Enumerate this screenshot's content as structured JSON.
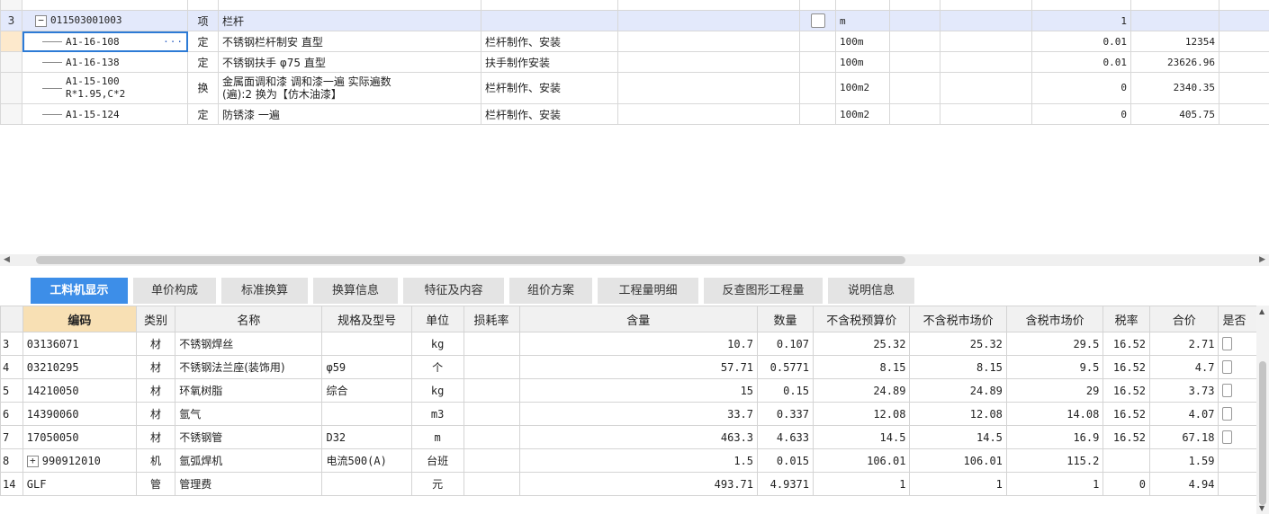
{
  "top_grid": {
    "rows": [
      {
        "idx": "",
        "code": "",
        "type": "",
        "name": "",
        "feature": "",
        "unit": "",
        "qty": "",
        "price": "",
        "partial": true
      },
      {
        "idx": "3",
        "code": "011503001003",
        "type": "项",
        "name": "栏杆",
        "feature": "",
        "unit": "m",
        "qty": "1",
        "price": "",
        "kind": "item"
      },
      {
        "idx": "",
        "code": "A1-16-108",
        "type": "定",
        "name": "不锈钢栏杆制安 直型",
        "feature": "栏杆制作、安装",
        "unit": "100m",
        "qty": "0.01",
        "price": "12354",
        "kind": "sub",
        "editing": true
      },
      {
        "idx": "",
        "code": "A1-16-138",
        "type": "定",
        "name": "不锈钢扶手 φ75 直型",
        "feature": "扶手制作安装",
        "unit": "100m",
        "qty": "0.01",
        "price": "23626.96",
        "kind": "sub"
      },
      {
        "idx": "",
        "code": "A1-15-100",
        "code2": "R*1.95,C*2",
        "type": "换",
        "name": "金属面调和漆 调和漆一遍  实际遍数",
        "name2": "(遍):2  换为【仿木油漆】",
        "feature": "栏杆制作、安装",
        "unit": "100m2",
        "qty": "0",
        "price": "2340.35",
        "kind": "sub2"
      },
      {
        "idx": "",
        "code": "A1-15-124",
        "type": "定",
        "name": "防锈漆 一遍",
        "feature": "栏杆制作、安装",
        "unit": "100m2",
        "qty": "0",
        "price": "405.75",
        "kind": "sub"
      }
    ]
  },
  "tabs": [
    "工料机显示",
    "单价构成",
    "标准换算",
    "换算信息",
    "特征及内容",
    "组价方案",
    "工程量明细",
    "反查图形工程量",
    "说明信息"
  ],
  "bottom_grid": {
    "headers": [
      "",
      "编码",
      "类别",
      "名称",
      "规格及型号",
      "单位",
      "损耗率",
      "含量",
      "数量",
      "不含税预算价",
      "不含税市场价",
      "含税市场价",
      "税率",
      "合价",
      "是否"
    ],
    "rows": [
      {
        "no": "3",
        "code": "03136071",
        "cat": "材",
        "name": "不锈钢焊丝",
        "spec": "",
        "unit": "kg",
        "loss": "",
        "content": "10.7",
        "qty": "0.107",
        "p1": "25.32",
        "p2": "25.32",
        "p3": "29.5",
        "tax": "16.52",
        "total": "2.71",
        "chk": true
      },
      {
        "no": "4",
        "code": "03210295",
        "cat": "材",
        "name": "不锈钢法兰座(装饰用)",
        "spec": "φ59",
        "unit": "个",
        "loss": "",
        "content": "57.71",
        "qty": "0.5771",
        "p1": "8.15",
        "p2": "8.15",
        "p3": "9.5",
        "tax": "16.52",
        "total": "4.7",
        "chk": true
      },
      {
        "no": "5",
        "code": "14210050",
        "cat": "材",
        "name": "环氧树脂",
        "spec": "综合",
        "unit": "kg",
        "loss": "",
        "content": "15",
        "qty": "0.15",
        "p1": "24.89",
        "p2": "24.89",
        "p3": "29",
        "tax": "16.52",
        "total": "3.73",
        "chk": true
      },
      {
        "no": "6",
        "code": "14390060",
        "cat": "材",
        "name": "氩气",
        "spec": "",
        "unit": "m3",
        "loss": "",
        "content": "33.7",
        "qty": "0.337",
        "p1": "12.08",
        "p2": "12.08",
        "p3": "14.08",
        "tax": "16.52",
        "total": "4.07",
        "chk": true
      },
      {
        "no": "7",
        "code": "17050050",
        "cat": "材",
        "name": "不锈钢管",
        "spec": "D32",
        "unit": "m",
        "loss": "",
        "content": "463.3",
        "qty": "4.633",
        "p1": "14.5",
        "p2": "14.5",
        "p3": "16.9",
        "tax": "16.52",
        "total": "67.18",
        "chk": true
      },
      {
        "no": "8",
        "code": "990912010",
        "cat": "机",
        "name": "氩弧焊机",
        "spec": "电流500(A)",
        "unit": "台班",
        "loss": "",
        "content": "1.5",
        "qty": "0.015",
        "p1": "106.01",
        "p2": "106.01",
        "p3": "115.2",
        "tax": "",
        "total": "1.59",
        "chk": false,
        "expand": true
      },
      {
        "no": "14",
        "code": "GLF",
        "cat": "管",
        "name": "管理费",
        "spec": "",
        "unit": "元",
        "loss": "",
        "content": "493.71",
        "qty": "4.9371",
        "p1": "1",
        "p2": "1",
        "p3": "1",
        "tax": "0",
        "total": "4.94",
        "chk": false
      }
    ]
  }
}
